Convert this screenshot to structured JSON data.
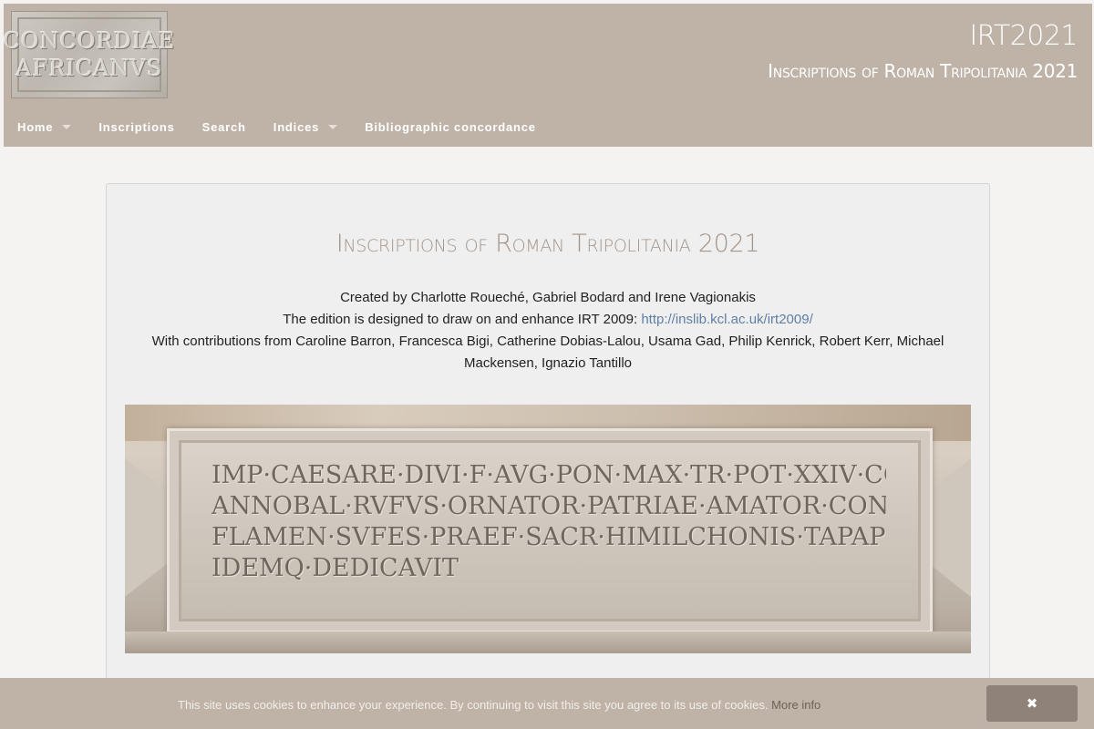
{
  "header": {
    "logo_lines": [
      "CONCORDIAE",
      "AFRICANVS"
    ],
    "title": "IRT2021",
    "subtitle": "Inscriptions of Roman Tripolitania 2021"
  },
  "nav": {
    "items": [
      {
        "label": "Home",
        "dropdown": true
      },
      {
        "label": "Inscriptions",
        "dropdown": false
      },
      {
        "label": "Search",
        "dropdown": false
      },
      {
        "label": "Indices",
        "dropdown": true
      },
      {
        "label": "Bibliographic concordance",
        "dropdown": false
      }
    ]
  },
  "main": {
    "title": "Inscriptions of Roman Tripolitania 2021",
    "credits_line1": "Created by Charlotte Roueché, Gabriel Bodard and Irene Vagionakis",
    "credits_line2_prefix": "The edition is designed to draw on and enhance IRT 2009: ",
    "credits_line2_link": "http://inslib.kcl.ac.uk/irt2009/",
    "credits_line3": "With contributions from Caroline Barron, Francesca Bigi, Catherine Dobias-Lalou, Usama Gad, Philip Kenrick, Robert Kerr, Michael Mackensen, Ignazio Tantillo",
    "banner_inscription": [
      "IMP·CAESARE·DIVI·F·AVG·PON·MAX·TR·POT·XXIV·COS·XIII·PAT·PATR",
      "ANNOBAL·RVFVS·ORNATOR·PATRIAE·AMATOR·CONCORDIAE",
      "FLAMEN·SVFES·PRAEF·SACR·HIMILCHONIS·TAPAPI·F·D·S·F·C·COER",
      "IDEMQ·DEDICAVIT",
      ""
    ]
  },
  "cookie": {
    "text": "This site uses cookies to enhance your experience. By continuing to visit this site you agree to its use of cookies.",
    "more_label": "More info",
    "close_label": "✖"
  },
  "colors": {
    "header_bg": "#bfb3a8",
    "title_color": "#a3958a",
    "link_color": "#5f7fa5",
    "close_button_bg": "#8f8279"
  }
}
